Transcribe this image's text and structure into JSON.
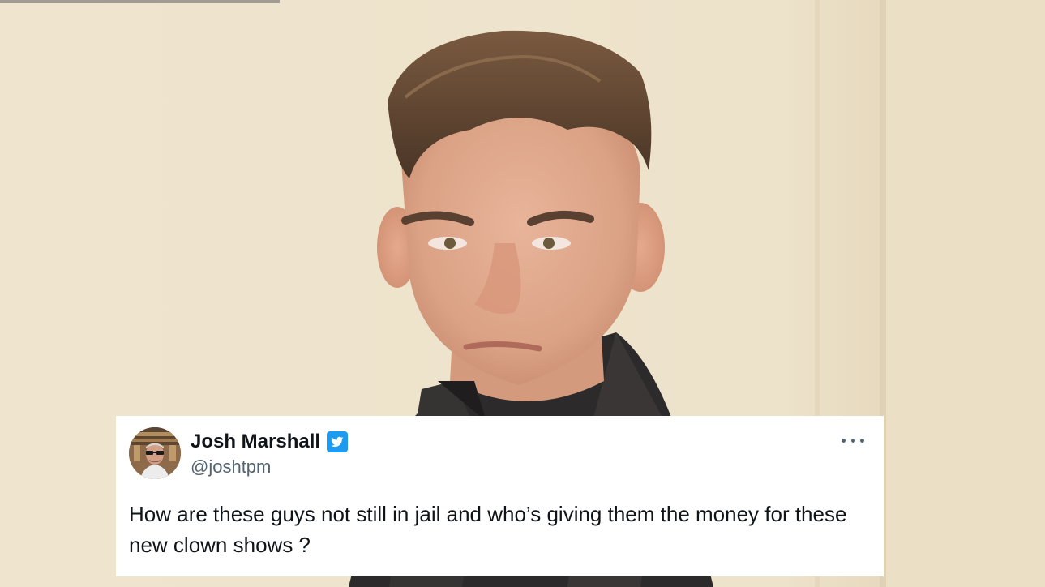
{
  "tweet": {
    "author_name": "Josh Marshall",
    "author_handle": "@joshtpm",
    "verified": true,
    "text": "How are these guys not still in jail and who’s giving them the money for these new clown shows ?",
    "avatar_icon": "profile-photo",
    "more_icon": "more-horizontal-icon",
    "verified_icon": "verified-badge-icon"
  },
  "colors": {
    "card_background": "#ffffff",
    "name_text": "#0f1419",
    "handle_text": "#536471",
    "verified_badge": "#1d9bf0",
    "background_wall": "#eee3cc"
  }
}
